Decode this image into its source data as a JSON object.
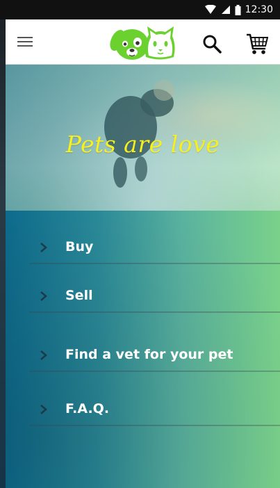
{
  "status_bar": {
    "time": "12:30"
  },
  "app_bar": {
    "menu_icon": "hamburger-menu-icon",
    "logo_icon": "dog-cat-logo-icon",
    "search_icon": "search-icon",
    "cart_icon": "shopping-cart-icon"
  },
  "hero": {
    "title": "Pets are love"
  },
  "menu": {
    "items": [
      {
        "label": "Buy",
        "icon": "chevron-right-icon"
      },
      {
        "label": "Sell",
        "icon": "chevron-right-icon"
      },
      {
        "label": "Find a vet for your pet",
        "icon": "chevron-right-icon"
      },
      {
        "label": "F.A.Q.",
        "icon": "chevron-right-icon"
      }
    ]
  },
  "colors": {
    "hero_title": "#f7f020",
    "logo_green": "#6ad12e",
    "gradient_start": "#0c6b8e",
    "gradient_end": "#7ad18a"
  }
}
